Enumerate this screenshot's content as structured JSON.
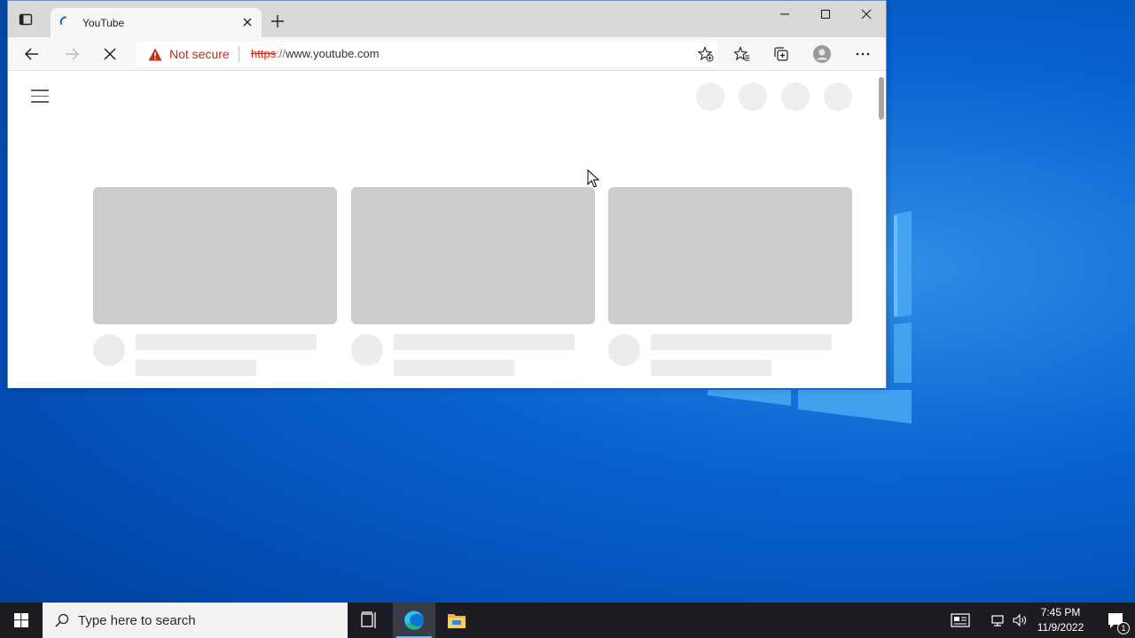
{
  "browser": {
    "tab": {
      "title": "YouTube"
    },
    "address": {
      "security_label": "Not secure",
      "url_protocol": "https",
      "url_separator": "://",
      "url_host": "www.youtube.com"
    }
  },
  "taskbar": {
    "search_placeholder": "Type here to search",
    "clock_time": "7:45 PM",
    "clock_date": "11/9/2022",
    "notification_count": "1"
  },
  "colors": {
    "not_secure": "#c42b1c",
    "desktop": "#0a64d2",
    "taskbar": "#1c1d22",
    "placeholder": "#cdcdcd"
  },
  "icons": [
    "tab-actions-icon",
    "loading-spinner-icon",
    "close-icon",
    "plus-icon",
    "minimize-icon",
    "maximize-icon",
    "back-icon",
    "forward-icon",
    "stop-icon",
    "warning-icon",
    "add-favorite-icon",
    "favorites-icon",
    "collections-icon",
    "profile-icon",
    "more-icon",
    "hamburger-icon",
    "windows-icon",
    "search-icon",
    "task-view-icon",
    "edge-icon",
    "file-explorer-icon",
    "news-icon",
    "network-icon",
    "volume-icon",
    "notification-icon"
  ]
}
